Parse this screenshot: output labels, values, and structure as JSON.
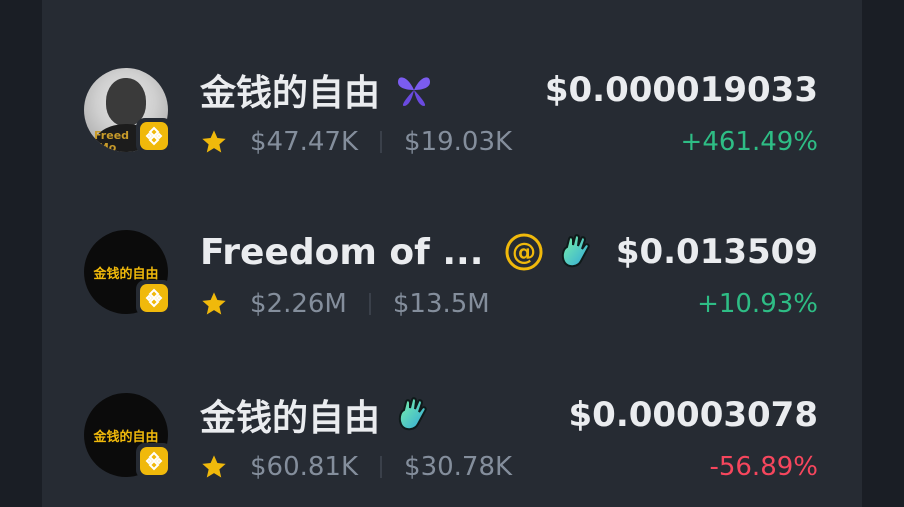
{
  "tokens": [
    {
      "name": "金钱的自由",
      "tag_icon": "butterfly-icon",
      "avatar_style": "photo",
      "avatar_caption": "Freed\nMo",
      "chain_icon": "bnb-chain-icon",
      "market_cap": "$47.47K",
      "liquidity": "$19.03K",
      "price": "$0.000019033",
      "change": "+461.49%",
      "change_direction": "up"
    },
    {
      "name": "Freedom of ...",
      "tag_icon": "at-icon",
      "tag_icon_2": "wave-hand-icon",
      "avatar_style": "dark",
      "avatar_text": "金钱的自由",
      "chain_icon": "bnb-chain-icon",
      "market_cap": "$2.26M",
      "liquidity": "$13.5M",
      "price": "$0.013509",
      "change": "+10.93%",
      "change_direction": "up"
    },
    {
      "name": "金钱的自由",
      "tag_icon": "wave-hand-icon",
      "avatar_style": "dark",
      "avatar_text": "金钱的自由",
      "chain_icon": "bnb-chain-icon",
      "market_cap": "$60.81K",
      "liquidity": "$30.78K",
      "price": "$0.00003078",
      "change": "-56.89%",
      "change_direction": "down"
    }
  ],
  "colors": {
    "background": "#262b33",
    "text_primary": "#eaecef",
    "text_secondary": "#848e9c",
    "positive": "#2ebd85",
    "negative": "#f6465d",
    "bnb_yellow": "#f0b90b",
    "star": "#f0b90b"
  }
}
